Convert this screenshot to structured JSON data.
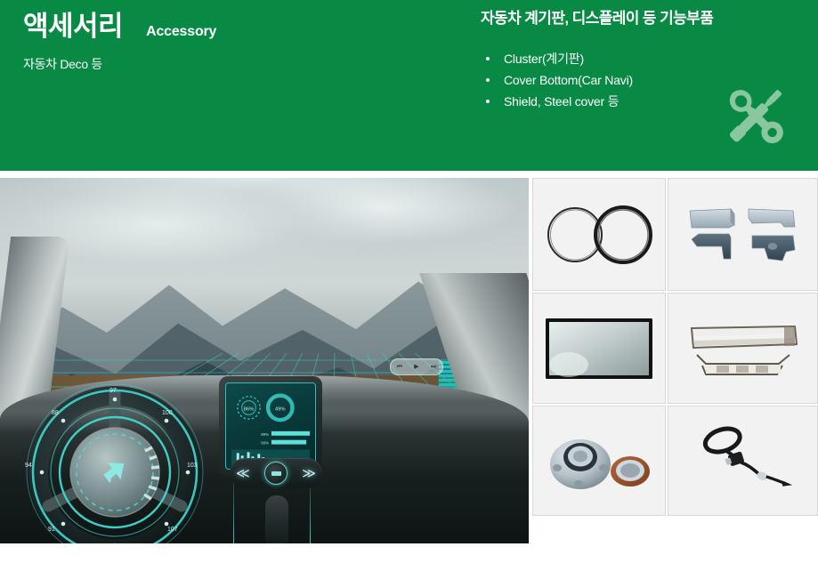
{
  "header": {
    "title_ko": "액세서리",
    "title_en": "Accessory",
    "subtitle_ko": "자동차 Deco 등",
    "right_title": "자동차 계기판, 디스플레이 등 기능부품",
    "bullets": [
      "Cluster(계기판)",
      "Cover Bottom(Car Navi)",
      "Shield, Steel cover 등"
    ],
    "icon": "wrench-screwdriver-icon",
    "background_color": "#088A44",
    "text_color": "#FFFFFF",
    "icon_color": "#8FC9A3"
  },
  "hero": {
    "name": "car-interior-hud-photo",
    "scene": "driver view through windshield of mountain landscape with cyan HUD overlay",
    "hud": {
      "accent_color": "#35D6D0",
      "cluster_values": [
        "88",
        "91",
        "94",
        "97",
        "100",
        "103",
        "107"
      ],
      "turn_arrow": "left-turn-arrow-icon",
      "gauge_left_label": "86%",
      "gauge_right_label": "49%",
      "bar_labels": [
        "89%",
        "89%"
      ]
    },
    "media_controls": {
      "prev": "⏮",
      "play": "▶",
      "next": "⏭"
    },
    "console_controls": {
      "rewind": "≪",
      "forward": "≫",
      "center": "center-button"
    }
  },
  "product_grid": {
    "cells": [
      {
        "name": "product-rings",
        "caption": "Two metal rings"
      },
      {
        "name": "product-brackets",
        "caption": "Four metal brackets"
      },
      {
        "name": "product-display-panel",
        "caption": "Display panel"
      },
      {
        "name": "product-frame-set",
        "caption": "Metal frame set"
      },
      {
        "name": "product-hub-bearing",
        "caption": "Hub bearing and seal ring"
      },
      {
        "name": "product-steering-shaft",
        "caption": "Steering wheel with shaft"
      }
    ],
    "cell_background": "#F2F2F2",
    "cell_border": "#D8D8D8"
  }
}
